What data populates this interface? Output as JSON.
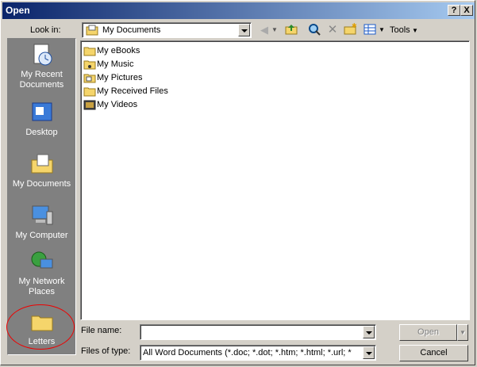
{
  "titlebar": {
    "title": "Open",
    "help_glyph": "?",
    "close_glyph": "X"
  },
  "toolbar": {
    "look_in_label": "Look in:",
    "look_in_value": "My Documents",
    "tools_label": "Tools",
    "icons": [
      "back-icon",
      "up-folder-icon",
      "search-web-icon",
      "delete-icon",
      "new-folder-icon",
      "views-icon"
    ]
  },
  "places": [
    {
      "label": "My Recent Documents",
      "icon": "recent-documents-icon"
    },
    {
      "label": "Desktop",
      "icon": "desktop-icon"
    },
    {
      "label": "My Documents",
      "icon": "my-documents-icon"
    },
    {
      "label": "My Computer",
      "icon": "my-computer-icon"
    },
    {
      "label": "My Network Places",
      "icon": "network-places-icon"
    },
    {
      "label": "Letters",
      "icon": "folder-icon"
    }
  ],
  "files": [
    {
      "name": "My eBooks",
      "icon": "folder-icon"
    },
    {
      "name": "My Music",
      "icon": "music-folder-icon"
    },
    {
      "name": "My Pictures",
      "icon": "pictures-folder-icon"
    },
    {
      "name": "My Received Files",
      "icon": "folder-icon"
    },
    {
      "name": "My Videos",
      "icon": "videos-folder-icon"
    }
  ],
  "bottom": {
    "file_name_label": "File name:",
    "file_name_value": "",
    "files_of_type_label": "Files of type:",
    "files_of_type_value": "All Word Documents (*.doc; *.dot; *.htm; *.html; *.url; *",
    "open_label": "Open",
    "cancel_label": "Cancel"
  },
  "colors": {
    "title_start": "#0a246a",
    "title_end": "#a6caf0",
    "annotation_circle": "#e00000",
    "folder": "#f5d56b"
  }
}
